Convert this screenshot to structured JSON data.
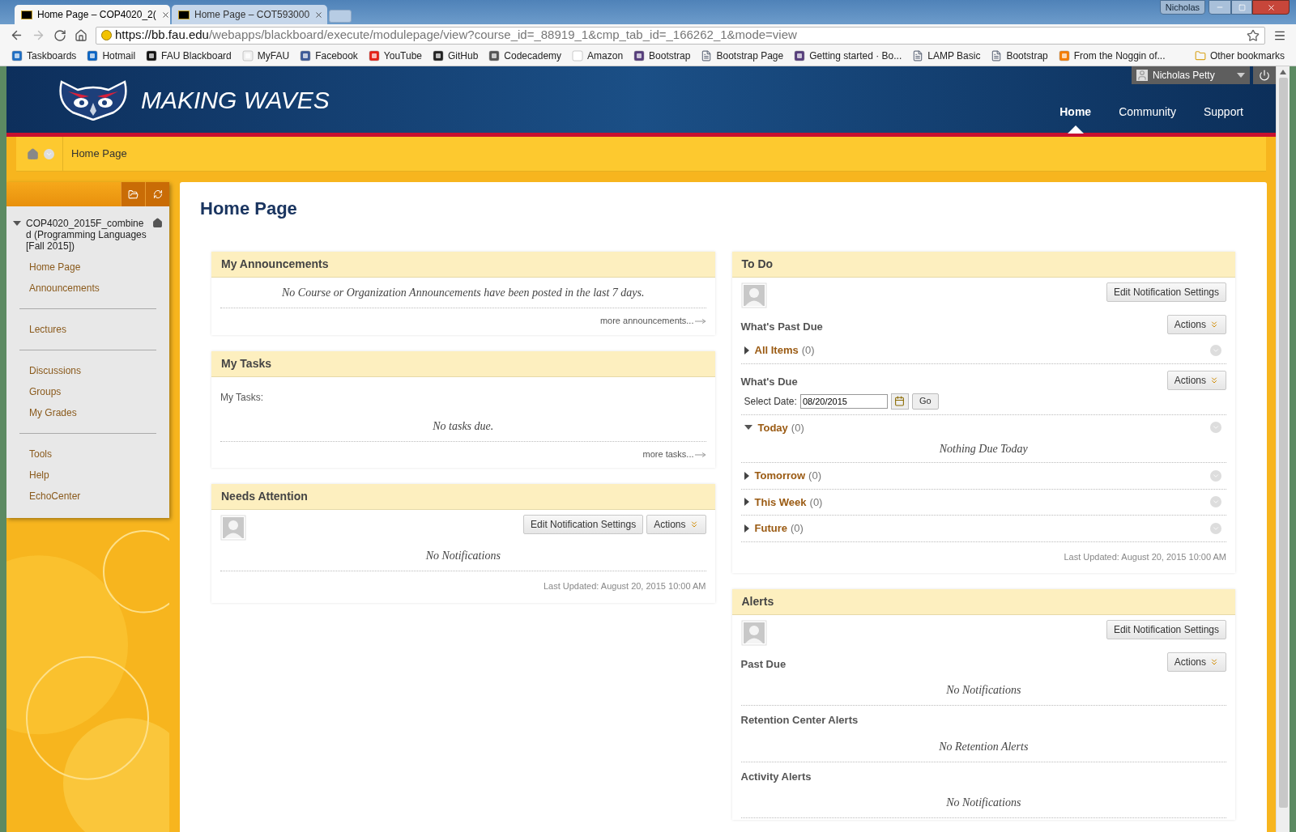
{
  "browser": {
    "tabs": [
      {
        "title": "Home Page – COP4020_2(",
        "selected": true
      },
      {
        "title": "Home Page – COT593000",
        "selected": false
      }
    ],
    "profile": "Nicholas",
    "url_host": "https://bb.fau.edu",
    "url_path": "/webapps/blackboard/execute/modulepage/view?course_id=_88919_1&cmp_tab_id=_166262_1&mode=view",
    "bookmarks": [
      {
        "label": "Taskboards"
      },
      {
        "label": "Hotmail"
      },
      {
        "label": "FAU Blackboard"
      },
      {
        "label": "MyFAU"
      },
      {
        "label": "Facebook"
      },
      {
        "label": "YouTube"
      },
      {
        "label": "GitHub"
      },
      {
        "label": "Codecademy"
      },
      {
        "label": "Amazon"
      },
      {
        "label": "Bootstrap"
      },
      {
        "label": "Bootstrap Page"
      },
      {
        "label": "Getting started · Bo..."
      },
      {
        "label": "LAMP Basic"
      },
      {
        "label": "Bootstrap"
      },
      {
        "label": "From the Noggin of..."
      }
    ],
    "other_bookmarks": "Other bookmarks"
  },
  "header": {
    "title": "MAKING WAVES",
    "user": "Nicholas Petty",
    "nav": [
      {
        "label": "Home",
        "selected": true
      },
      {
        "label": "Community",
        "selected": false
      },
      {
        "label": "Support",
        "selected": false
      }
    ]
  },
  "breadcrumb": "Home Page",
  "sidebar": {
    "course": "COP4020_2015F_combined (Programming Languages [Fall 2015])",
    "groups": [
      [
        "Home Page",
        "Announcements"
      ],
      [
        "Lectures"
      ],
      [
        "Discussions",
        "Groups",
        "My Grades"
      ],
      [
        "Tools",
        "Help",
        "EchoCenter"
      ]
    ]
  },
  "page_title": "Home Page",
  "columns": [
    [
      {
        "title": "My Announcements",
        "blocks": [
          {
            "kind": "message",
            "text": "No Course or Organization Announcements have been posted in the last 7 days."
          },
          {
            "kind": "more",
            "text": "more announcements..."
          }
        ]
      },
      {
        "title": "My Tasks",
        "blocks": [
          {
            "kind": "label",
            "text": "My Tasks:"
          },
          {
            "kind": "message",
            "text": "No tasks due."
          },
          {
            "kind": "more",
            "text": "more tasks..."
          }
        ]
      },
      {
        "title": "Needs Attention",
        "blocks": [
          {
            "kind": "avatar",
            "buttons": [
              {
                "label": "Edit Notification Settings",
                "menu": false
              },
              {
                "label": "Actions",
                "menu": true
              }
            ]
          },
          {
            "kind": "message",
            "text": "No Notifications"
          },
          {
            "kind": "updated",
            "text": "Last Updated: August 20, 2015 10:00 AM"
          }
        ]
      }
    ],
    [
      {
        "title": "To Do",
        "blocks": [
          {
            "kind": "avatar",
            "buttons": [
              {
                "label": "Edit Notification Settings",
                "menu": false
              }
            ]
          },
          {
            "kind": "heading",
            "text": "What's Past Due",
            "action": "Actions"
          },
          {
            "kind": "disclosure",
            "label": "All Items",
            "count": "(0)",
            "expanded": false
          },
          {
            "kind": "heading",
            "text": "What's Due",
            "action": "Actions"
          },
          {
            "kind": "date",
            "label": "Select Date:",
            "value": "08/20/2015",
            "button": "Go"
          },
          {
            "kind": "disclosure",
            "label": "Today",
            "count": "(0)",
            "expanded": true,
            "message": "Nothing Due Today"
          },
          {
            "kind": "disclosure",
            "label": "Tomorrow",
            "count": "(0)",
            "expanded": false
          },
          {
            "kind": "disclosure",
            "label": "This Week",
            "count": "(0)",
            "expanded": false
          },
          {
            "kind": "disclosure",
            "label": "Future",
            "count": "(0)",
            "expanded": false
          },
          {
            "kind": "updated",
            "text": "Last Updated: August 20, 2015 10:00 AM"
          }
        ]
      },
      {
        "title": "Alerts",
        "blocks": [
          {
            "kind": "avatar",
            "buttons": [
              {
                "label": "Edit Notification Settings",
                "menu": false
              }
            ]
          },
          {
            "kind": "heading",
            "text": "Past Due",
            "action": "Actions"
          },
          {
            "kind": "message",
            "text": "No Notifications"
          },
          {
            "kind": "heading",
            "text": "Retention Center Alerts"
          },
          {
            "kind": "message",
            "text": "No Retention Alerts"
          },
          {
            "kind": "heading",
            "text": "Activity Alerts"
          },
          {
            "kind": "message",
            "text": "No Notifications"
          }
        ]
      }
    ]
  ]
}
